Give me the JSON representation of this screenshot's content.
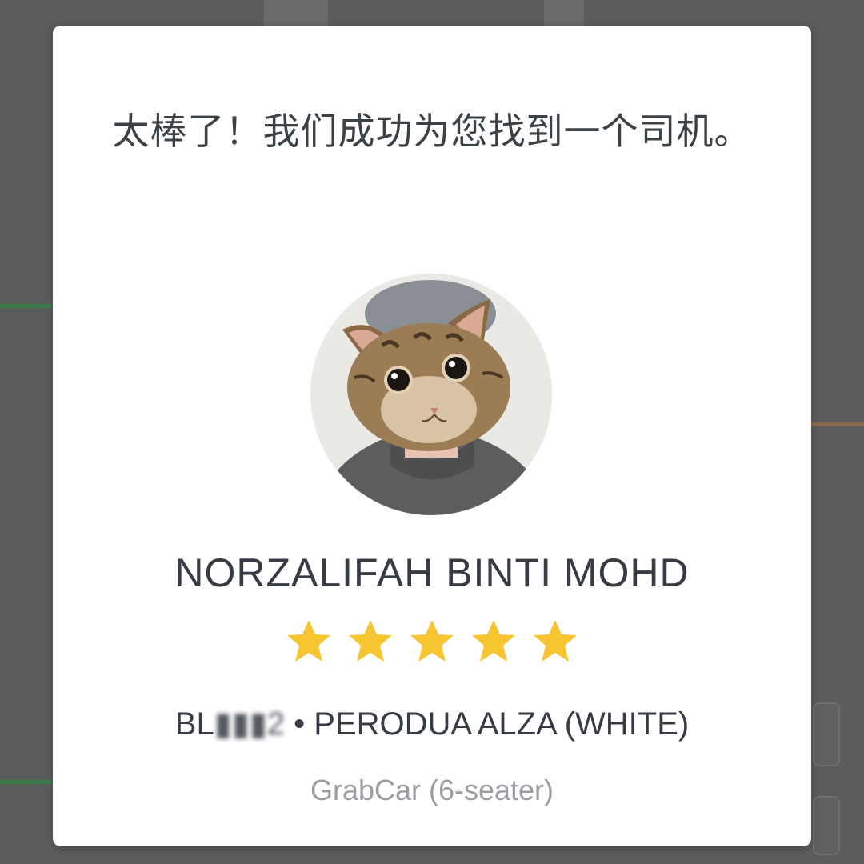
{
  "dialog": {
    "title": "太棒了！我们成功为您找到一个司机。"
  },
  "driver": {
    "name": "NORZALIFAH BINTI MOHD",
    "rating_stars": 5,
    "rating_max": 5,
    "plate": "BL",
    "plate_obscured": "▮▮▮2",
    "vehicle": "• PERODUA ALZA (WHITE)",
    "service": "GrabCar (6-seater)",
    "avatar": "driver-avatar-cat-face"
  },
  "colors": {
    "star": "#f6c531",
    "dialog_bg": "#ffffff",
    "backdrop": "#5b5c5e",
    "text_primary": "#363b44",
    "text_secondary": "#9a9da1"
  }
}
